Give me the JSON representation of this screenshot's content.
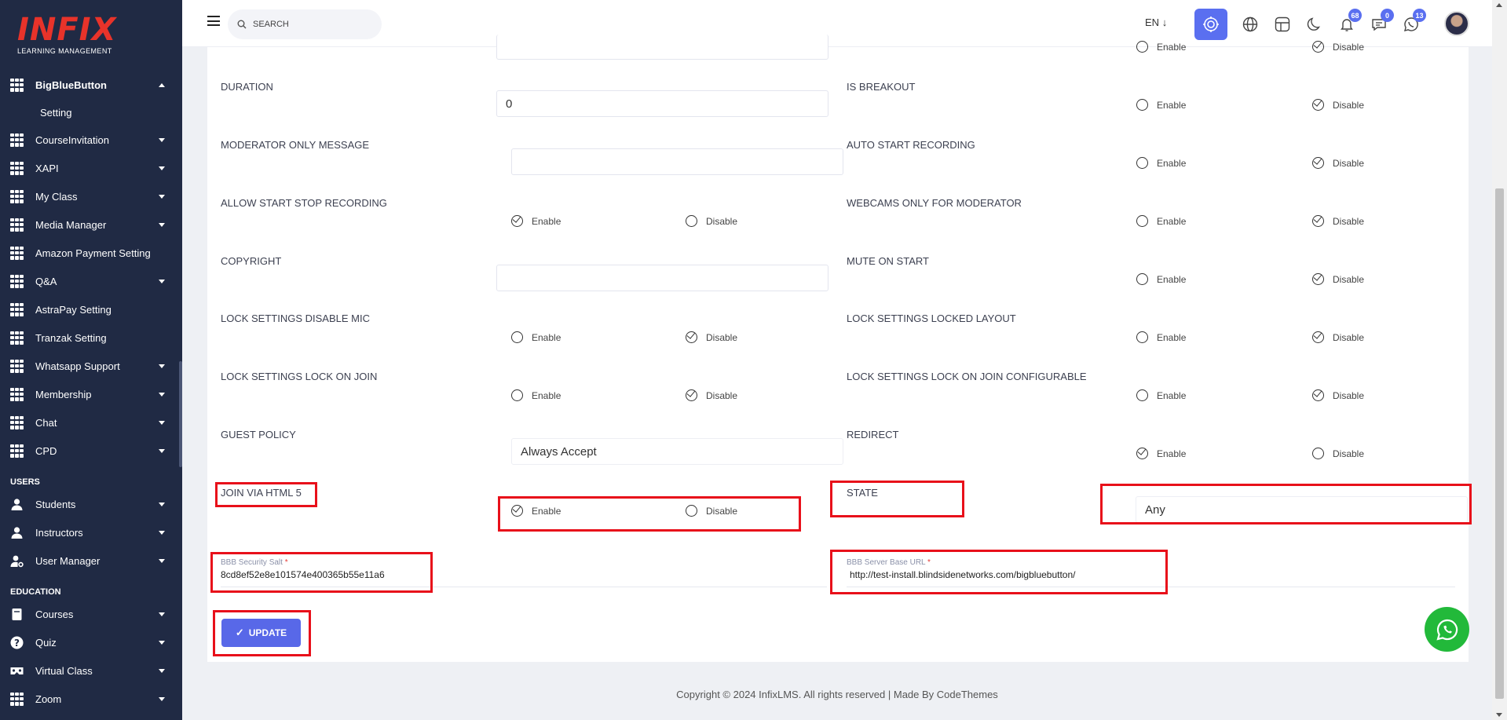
{
  "brand": {
    "logo": "INFIX",
    "tagline": "LEARNING MANAGEMENT"
  },
  "sidebar": {
    "top_items": [
      {
        "label": "BigBlueButton",
        "expanded": true,
        "icon": "grid-icon"
      },
      {
        "label": "CourseInvitation",
        "icon": "grid-icon"
      },
      {
        "label": "XAPI",
        "icon": "grid-icon"
      },
      {
        "label": "My Class",
        "icon": "grid-icon"
      },
      {
        "label": "Media Manager",
        "icon": "grid-icon"
      },
      {
        "label": "Amazon Payment Setting",
        "icon": "grid-icon"
      },
      {
        "label": "Q&A",
        "icon": "grid-icon"
      },
      {
        "label": "AstraPay Setting",
        "icon": "grid-icon"
      },
      {
        "label": "Tranzak Setting",
        "icon": "grid-icon"
      },
      {
        "label": "Whatsapp Support",
        "icon": "grid-icon"
      },
      {
        "label": "Membership",
        "icon": "grid-icon"
      },
      {
        "label": "Chat",
        "icon": "grid-icon"
      },
      {
        "label": "CPD",
        "icon": "grid-icon"
      }
    ],
    "sub_item": "Setting",
    "users_heading": "USERS",
    "users_items": [
      {
        "label": "Students",
        "icon": "user-icon"
      },
      {
        "label": "Instructors",
        "icon": "user-icon"
      },
      {
        "label": "User Manager",
        "icon": "user-gear-icon"
      }
    ],
    "education_heading": "EDUCATION",
    "education_items": [
      {
        "label": "Courses",
        "icon": "book-icon"
      },
      {
        "label": "Quiz",
        "icon": "question-icon"
      },
      {
        "label": "Virtual Class",
        "icon": "vr-icon"
      },
      {
        "label": "Zoom",
        "icon": "grid-icon"
      }
    ]
  },
  "header": {
    "search_placeholder": "SEARCH",
    "language": "EN",
    "notifications_count": "68",
    "messages_count": "0",
    "whatsapp_count": "13"
  },
  "form": {
    "duration": {
      "label": "DURATION",
      "value": "0"
    },
    "is_breakout": {
      "label": "IS BREAKOUT",
      "enable": "Enable",
      "disable": "Disable",
      "selected": "disable"
    },
    "moderator_only_message": {
      "label": "MODERATOR ONLY MESSAGE",
      "value": ""
    },
    "auto_start_recording": {
      "label": "AUTO START RECORDING",
      "enable": "Enable",
      "disable": "Disable",
      "selected": "disable"
    },
    "allow_start_stop_recording": {
      "label": "ALLOW START STOP RECORDING",
      "enable": "Enable",
      "disable": "Disable",
      "selected": "enable"
    },
    "webcams_only_for_moderator": {
      "label": "WEBCAMS ONLY FOR MODERATOR",
      "enable": "Enable",
      "disable": "Disable",
      "selected": "disable"
    },
    "copyright": {
      "label": "COPYRIGHT",
      "value": ""
    },
    "mute_on_start": {
      "label": "MUTE ON START",
      "enable": "Enable",
      "disable": "Disable",
      "selected": "disable"
    },
    "lock_disable_mic": {
      "label": "LOCK SETTINGS DISABLE MIC",
      "enable": "Enable",
      "disable": "Disable",
      "selected": "disable"
    },
    "lock_locked_layout": {
      "label": "LOCK SETTINGS LOCKED LAYOUT",
      "enable": "Enable",
      "disable": "Disable",
      "selected": "disable"
    },
    "lock_on_join": {
      "label": "LOCK SETTINGS LOCK ON JOIN",
      "enable": "Enable",
      "disable": "Disable",
      "selected": "disable"
    },
    "lock_on_join_configurable": {
      "label": "LOCK SETTINGS LOCK ON JOIN CONFIGURABLE",
      "enable": "Enable",
      "disable": "Disable",
      "selected": "disable"
    },
    "guest_policy": {
      "label": "GUEST POLICY",
      "value": "Always Accept"
    },
    "redirect": {
      "label": "REDIRECT",
      "enable": "Enable",
      "disable": "Disable",
      "selected": "enable"
    },
    "join_via_html5": {
      "label": "JOIN VIA HTML 5",
      "enable": "Enable",
      "disable": "Disable",
      "selected": "enable"
    },
    "state": {
      "label": "STATE",
      "value": "Any"
    },
    "security_salt": {
      "label": "BBB Security Salt",
      "required": "*",
      "value": "8cd8ef52e8e101574e400365b55e11a6"
    },
    "server_base_url": {
      "label": "BBB Server Base URL",
      "required": "*",
      "value": "http://test-install.blindsidenetworks.com/bigbluebutton/"
    },
    "update_label": "UPDATE",
    "top_partial": {
      "enable": "Enable",
      "disable": "Disable"
    }
  },
  "footer": {
    "text": "Copyright © 2024 InfixLMS. All rights reserved | Made By CodeThemes"
  },
  "colors": {
    "sidebar": "#202a44",
    "accent": "#5868e8",
    "highlight": "#e8101a",
    "whatsapp": "#22b93a"
  }
}
